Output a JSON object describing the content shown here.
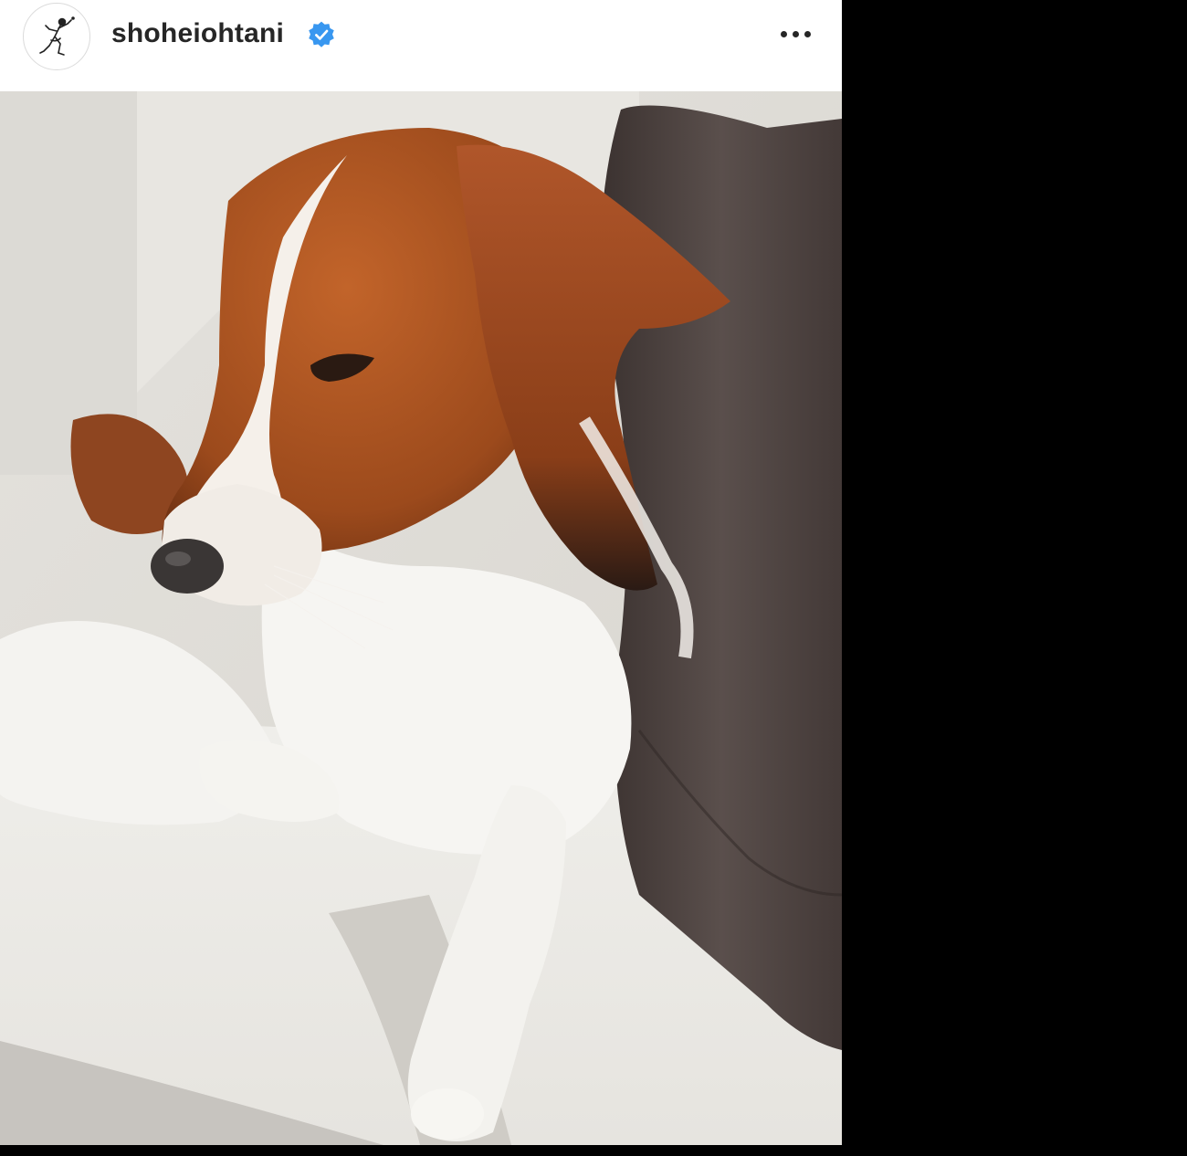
{
  "post": {
    "username": "shoheiohtani",
    "verified": true,
    "avatar_icon": "pitcher-sketch-avatar",
    "more_icon": "more-options-icon",
    "photo_subject": "dog-photo"
  },
  "colors": {
    "verified_badge": "#3897f0",
    "background": "#000000",
    "header_bg": "#ffffff",
    "text": "#262626"
  }
}
